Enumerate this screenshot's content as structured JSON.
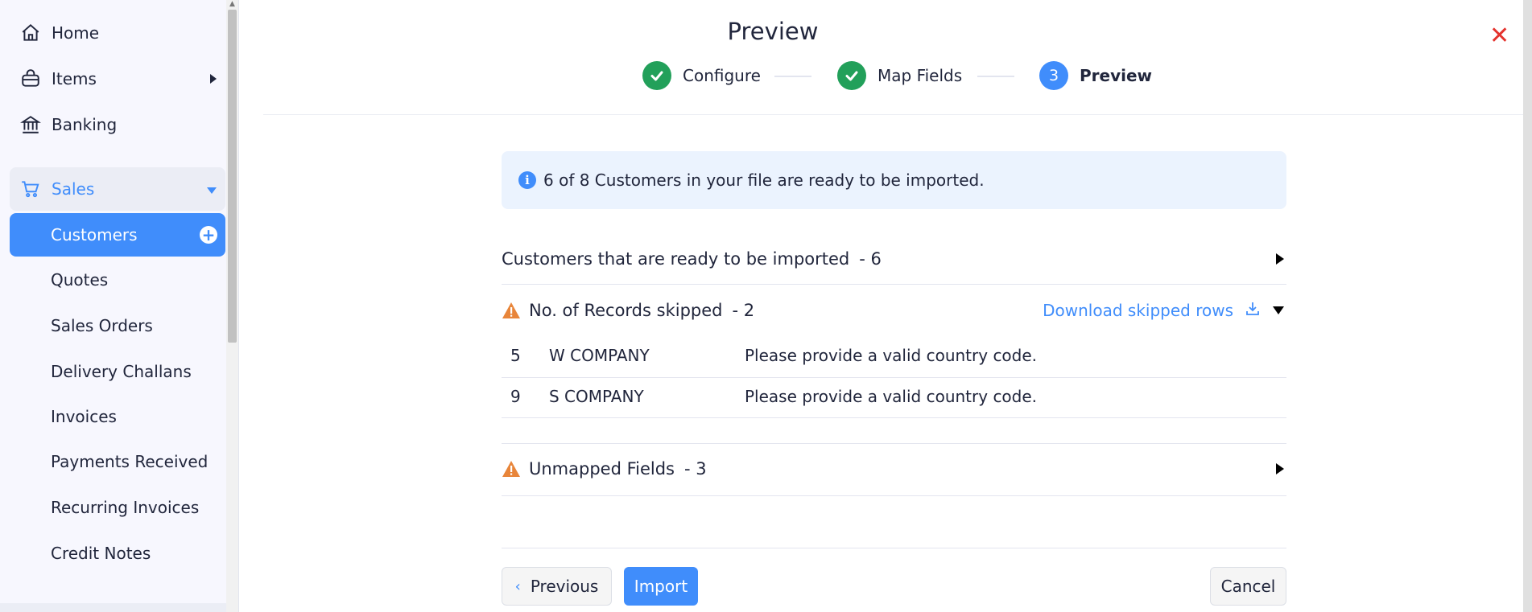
{
  "sidebar": {
    "nav": [
      {
        "label": "Home",
        "icon": "home-icon"
      },
      {
        "label": "Items",
        "icon": "basket-icon"
      },
      {
        "label": "Banking",
        "icon": "bank-icon"
      }
    ],
    "sales": {
      "label": "Sales",
      "icon": "cart-icon"
    },
    "sub_items": [
      {
        "label": "Customers",
        "active": true
      },
      {
        "label": "Quotes"
      },
      {
        "label": "Sales Orders"
      },
      {
        "label": "Delivery Challans"
      },
      {
        "label": "Invoices"
      },
      {
        "label": "Payments Received"
      },
      {
        "label": "Recurring Invoices"
      },
      {
        "label": "Credit Notes"
      }
    ]
  },
  "dialog": {
    "title": "Preview",
    "steps": [
      {
        "label": "Configure",
        "state": "done"
      },
      {
        "label": "Map Fields",
        "state": "done"
      },
      {
        "label": "Preview",
        "state": "current",
        "number": "3"
      }
    ],
    "info_message": "6 of 8 Customers in your file are ready to be imported.",
    "ready_section": {
      "label": "Customers that are ready to be imported",
      "count": "- 6"
    },
    "skipped_section": {
      "label": "No. of Records skipped",
      "count": "- 2",
      "download_label": "Download skipped rows",
      "rows": [
        {
          "row": "5",
          "name": "W COMPANY",
          "reason": "Please provide a valid country code."
        },
        {
          "row": "9",
          "name": "S COMPANY",
          "reason": "Please provide a valid country code."
        }
      ]
    },
    "unmapped_section": {
      "label": "Unmapped Fields",
      "count": "- 3"
    },
    "buttons": {
      "previous": "Previous",
      "import": "Import",
      "cancel": "Cancel"
    }
  },
  "colors": {
    "accent": "#408dfb",
    "success": "#22a05a",
    "warning": "#e8853a",
    "close": "#e4322d"
  }
}
